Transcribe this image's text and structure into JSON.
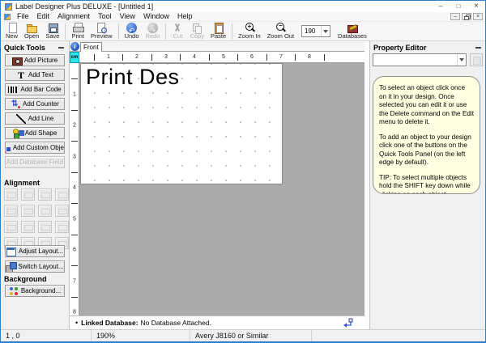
{
  "window": {
    "title": "Label Designer Plus DELUXE - [Untitled 1]"
  },
  "menu_bar": {
    "items": [
      "File",
      "Edit",
      "Alignment",
      "Tool",
      "View",
      "Window",
      "Help"
    ]
  },
  "toolbar": {
    "items": [
      {
        "type": "button",
        "label": "New",
        "icon": "new-document-icon",
        "enabled": true
      },
      {
        "type": "button",
        "label": "Open",
        "icon": "open-folder-icon",
        "enabled": true
      },
      {
        "type": "button",
        "label": "Save",
        "icon": "save-icon",
        "enabled": true
      },
      {
        "type": "separator"
      },
      {
        "type": "button",
        "label": "Print",
        "icon": "print-icon",
        "enabled": true
      },
      {
        "type": "button",
        "label": "Preview",
        "icon": "preview-icon",
        "enabled": true
      },
      {
        "type": "separator"
      },
      {
        "type": "button",
        "label": "Undo",
        "icon": "undo-icon",
        "enabled": true
      },
      {
        "type": "button",
        "label": "Redo",
        "icon": "redo-icon",
        "enabled": false
      },
      {
        "type": "separator"
      },
      {
        "type": "button",
        "label": "Cut",
        "icon": "cut-icon",
        "enabled": false
      },
      {
        "type": "button",
        "label": "Copy",
        "icon": "copy-icon",
        "enabled": false
      },
      {
        "type": "button",
        "label": "Paste",
        "icon": "paste-icon",
        "enabled": true
      },
      {
        "type": "separator"
      },
      {
        "type": "button",
        "label": "Zoom In",
        "icon": "zoom-in-icon",
        "enabled": true
      },
      {
        "type": "button",
        "label": "Zoom Out",
        "icon": "zoom-out-icon",
        "enabled": true
      },
      {
        "type": "combo",
        "value": "190"
      },
      {
        "type": "button",
        "label": "Databases",
        "icon": "databases-icon",
        "enabled": true
      }
    ]
  },
  "quick_tools": {
    "title": "Quick Tools",
    "buttons": [
      {
        "label": "Add Picture",
        "icon": "camera-icon",
        "enabled": true
      },
      {
        "label": "Add Text",
        "icon": "text-icon",
        "enabled": true
      },
      {
        "label": "Add Bar Code",
        "icon": "barcode-icon",
        "enabled": true
      },
      {
        "label": "Add Counter",
        "icon": "counter-icon",
        "enabled": true
      },
      {
        "label": "Add Line",
        "icon": "line-icon",
        "enabled": true
      },
      {
        "label": "Add Shape",
        "icon": "shape-icon",
        "enabled": true
      },
      {
        "label": "Add Custom Object",
        "icon": "custom-object-icon",
        "enabled": true
      },
      {
        "label": "Add Database Field",
        "icon": "none",
        "enabled": false
      }
    ],
    "alignment_title": "Alignment",
    "alignment_button_count": 16,
    "adjust_layout_label": "Adjust Layout...",
    "switch_layout_label": "Switch Layout...",
    "background_title": "Background",
    "background_label": "Background..."
  },
  "design_area": {
    "tab_label": "Front",
    "unit_label": "cm",
    "h_ruler_numbers": [
      1,
      2,
      3,
      4,
      5,
      6,
      7,
      8
    ],
    "v_ruler_numbers": [
      1,
      2,
      3,
      4,
      5,
      6,
      7,
      8
    ],
    "label_text": "Print Des",
    "linked_database_label": "Linked Database:",
    "linked_database_value": "No Database Attached."
  },
  "property_editor": {
    "title": "Property Editor",
    "selector_value": "",
    "help_paragraphs": [
      "To select an object click once on it in your design. Once selected you can edit it or use the Delete command on the Edit menu to delete it.",
      "To add an object to your design click one of the buttons on the Quick Tools Panel (on the left edge by default).",
      "TIP: To select multiple objects hold the SHIFT key down while clicking on each object."
    ]
  },
  "status_bar": {
    "cells": [
      "1 , 0",
      "190%",
      "Avery J8160 or Similar",
      ""
    ]
  },
  "colors": {
    "window_border": "#2a7fd0",
    "canvas_gray": "#ababab",
    "help_box_bg": "#ffffe1",
    "unit_button_bg": "#2ee6ee",
    "undo_icon_blue": "#1b50b8"
  }
}
